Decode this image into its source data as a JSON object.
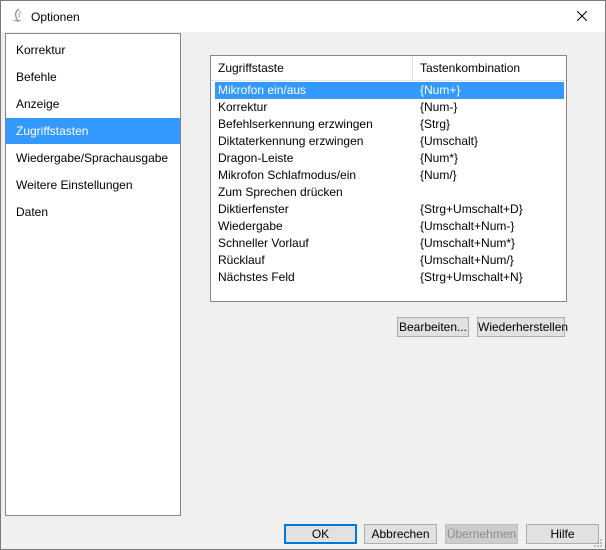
{
  "window": {
    "title": "Optionen",
    "icon": "optionen-app-icon",
    "close_icon": "close-icon"
  },
  "sidebar": {
    "selected_index": 3,
    "items": [
      {
        "label": "Korrektur"
      },
      {
        "label": "Befehle"
      },
      {
        "label": "Anzeige"
      },
      {
        "label": "Zugriffstasten"
      },
      {
        "label": "Wiedergabe/Sprachausgabe"
      },
      {
        "label": "Weitere Einstellungen"
      },
      {
        "label": "Daten"
      }
    ]
  },
  "shortcuts": {
    "columns": [
      "Zugriffstaste",
      "Tastenkombination"
    ],
    "selected_index": 0,
    "rows": [
      {
        "name": "Mikrofon ein/aus",
        "keys": "{Num+}"
      },
      {
        "name": "Korrektur",
        "keys": "{Num-}"
      },
      {
        "name": "Befehlserkennung erzwingen",
        "keys": "{Strg}"
      },
      {
        "name": "Diktaterkennung erzwingen",
        "keys": "{Umschalt}"
      },
      {
        "name": "Dragon-Leiste",
        "keys": "{Num*}"
      },
      {
        "name": "Mikrofon Schlafmodus/ein",
        "keys": "{Num/}"
      },
      {
        "name": "Zum Sprechen drücken",
        "keys": ""
      },
      {
        "name": "Diktierfenster",
        "keys": "{Strg+Umschalt+D}"
      },
      {
        "name": "Wiedergabe",
        "keys": "{Umschalt+Num-}"
      },
      {
        "name": "Schneller Vorlauf",
        "keys": "{Umschalt+Num*}"
      },
      {
        "name": "Rücklauf",
        "keys": "{Umschalt+Num/}"
      },
      {
        "name": "Nächstes Feld",
        "keys": "{Strg+Umschalt+N}"
      }
    ]
  },
  "actions": {
    "edit_label": "Bearbeiten...",
    "restore_label": "Wiederherstellen"
  },
  "footer": {
    "ok_label": "OK",
    "cancel_label": "Abbrechen",
    "apply_label": "Übernehmen",
    "help_label": "Hilfe"
  },
  "colors": {
    "selection": "#3399ff",
    "default_button_border": "#0078d7"
  }
}
